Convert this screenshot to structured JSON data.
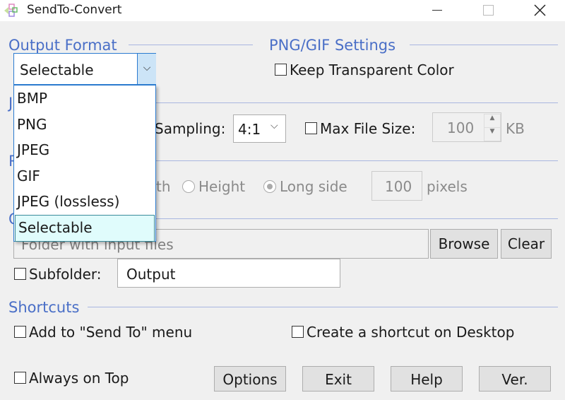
{
  "window": {
    "title": "SendTo-Convert",
    "minimize_icon": "minimize-icon",
    "maximize_icon": "maximize-icon",
    "close_icon": "close-icon"
  },
  "output_format": {
    "label": "Output Format",
    "selected": "Selectable",
    "options": [
      "BMP",
      "PNG",
      "JPEG",
      "GIF",
      "JPEG (lossless)",
      "Selectable"
    ]
  },
  "png_gif": {
    "label": "PNG/GIF Settings",
    "keep_transparent": "Keep Transparent Color"
  },
  "jpeg": {
    "label_visible": "J",
    "sampling_label": "Sampling:",
    "sampling_value": "4:1",
    "max_file_size_label": "Max File Size:",
    "max_file_size_value": "100",
    "unit": "KB"
  },
  "resize": {
    "label_visible": "R",
    "width_partial": "th",
    "height": "Height",
    "long_side": "Long side",
    "value": "100",
    "unit": "pixels"
  },
  "output": {
    "label_visible": "O",
    "folder_placeholder": "Folder with input files",
    "browse": "Browse",
    "clear": "Clear",
    "subfolder_label": "Subfolder:",
    "subfolder_value": "Output"
  },
  "shortcuts": {
    "label": "Shortcuts",
    "send_to": "Add to \"Send To\" menu",
    "desktop": "Create a shortcut on Desktop"
  },
  "footer": {
    "always_on_top": "Always on Top",
    "options": "Options",
    "exit": "Exit",
    "help": "Help",
    "ver": "Ver."
  },
  "colors": {
    "group_label": "#4a6fc7",
    "accent": "#2b7bd0",
    "selected_option": "#e0fcfc"
  }
}
